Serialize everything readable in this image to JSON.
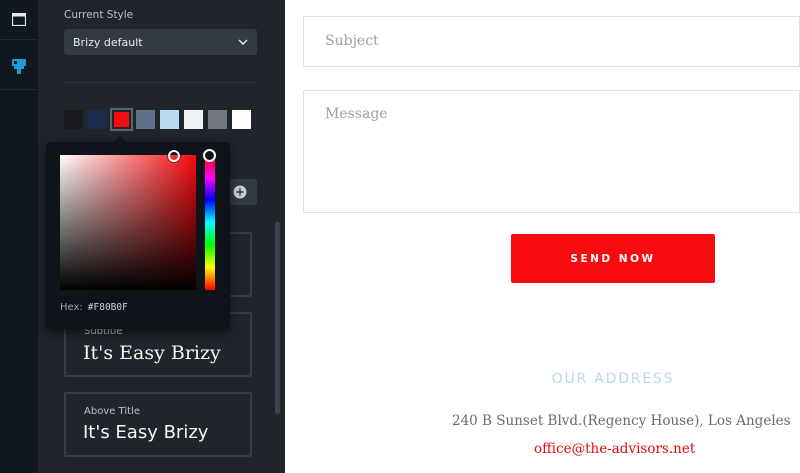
{
  "sidebar": {
    "current_style_label": "Current Style",
    "style_select": {
      "value": "Brizy default"
    },
    "swatches": [
      {
        "name": "black",
        "color": "#191b1f"
      },
      {
        "name": "navy",
        "color": "#1c2a4c"
      },
      {
        "name": "red",
        "color": "#f80b0f",
        "selected": true
      },
      {
        "name": "slate",
        "color": "#63708a"
      },
      {
        "name": "light-blue",
        "color": "#b8dcf0"
      },
      {
        "name": "white-ish",
        "color": "#eef0f2"
      },
      {
        "name": "gray",
        "color": "#73777e"
      },
      {
        "name": "white",
        "color": "#ffffff"
      }
    ],
    "cards": [
      {
        "label": "Subtitle",
        "title": "It's Easy Brizy"
      },
      {
        "label": "Above Title",
        "title": "It's Easy Brizy"
      }
    ]
  },
  "color_picker": {
    "hex_label": "Hex:",
    "hex_value": "#F80B0F"
  },
  "form": {
    "subject_placeholder": "Subject",
    "message_placeholder": "Message",
    "send_label": "SEND NOW"
  },
  "address": {
    "title": "OUR ADDRESS",
    "line": "240 B Sunset Blvd.(Regency House), Los Angeles",
    "email": "office@the-advisors.net"
  },
  "colors": {
    "accent": "#f80b0f",
    "sidebar_bg": "#20252c",
    "rail_bg": "#121820"
  }
}
